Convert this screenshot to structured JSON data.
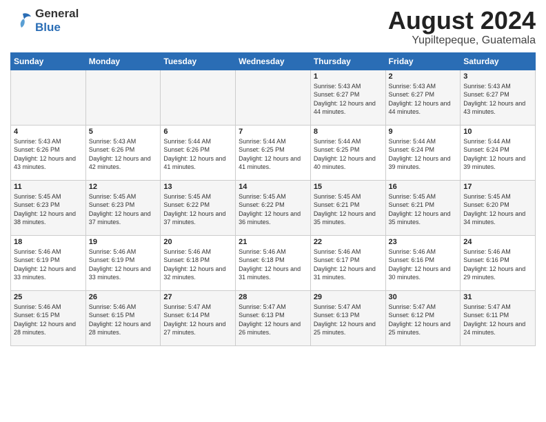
{
  "logo": {
    "general": "General",
    "blue": "Blue"
  },
  "title": {
    "month": "August 2024",
    "location": "Yupiltepeque, Guatemala"
  },
  "days_of_week": [
    "Sunday",
    "Monday",
    "Tuesday",
    "Wednesday",
    "Thursday",
    "Friday",
    "Saturday"
  ],
  "weeks": [
    [
      {
        "day": "",
        "sunrise": "",
        "sunset": "",
        "daylight": ""
      },
      {
        "day": "",
        "sunrise": "",
        "sunset": "",
        "daylight": ""
      },
      {
        "day": "",
        "sunrise": "",
        "sunset": "",
        "daylight": ""
      },
      {
        "day": "",
        "sunrise": "",
        "sunset": "",
        "daylight": ""
      },
      {
        "day": "1",
        "sunrise": "Sunrise: 5:43 AM",
        "sunset": "Sunset: 6:27 PM",
        "daylight": "Daylight: 12 hours and 44 minutes."
      },
      {
        "day": "2",
        "sunrise": "Sunrise: 5:43 AM",
        "sunset": "Sunset: 6:27 PM",
        "daylight": "Daylight: 12 hours and 44 minutes."
      },
      {
        "day": "3",
        "sunrise": "Sunrise: 5:43 AM",
        "sunset": "Sunset: 6:27 PM",
        "daylight": "Daylight: 12 hours and 43 minutes."
      }
    ],
    [
      {
        "day": "4",
        "sunrise": "Sunrise: 5:43 AM",
        "sunset": "Sunset: 6:26 PM",
        "daylight": "Daylight: 12 hours and 43 minutes."
      },
      {
        "day": "5",
        "sunrise": "Sunrise: 5:43 AM",
        "sunset": "Sunset: 6:26 PM",
        "daylight": "Daylight: 12 hours and 42 minutes."
      },
      {
        "day": "6",
        "sunrise": "Sunrise: 5:44 AM",
        "sunset": "Sunset: 6:26 PM",
        "daylight": "Daylight: 12 hours and 41 minutes."
      },
      {
        "day": "7",
        "sunrise": "Sunrise: 5:44 AM",
        "sunset": "Sunset: 6:25 PM",
        "daylight": "Daylight: 12 hours and 41 minutes."
      },
      {
        "day": "8",
        "sunrise": "Sunrise: 5:44 AM",
        "sunset": "Sunset: 6:25 PM",
        "daylight": "Daylight: 12 hours and 40 minutes."
      },
      {
        "day": "9",
        "sunrise": "Sunrise: 5:44 AM",
        "sunset": "Sunset: 6:24 PM",
        "daylight": "Daylight: 12 hours and 39 minutes."
      },
      {
        "day": "10",
        "sunrise": "Sunrise: 5:44 AM",
        "sunset": "Sunset: 6:24 PM",
        "daylight": "Daylight: 12 hours and 39 minutes."
      }
    ],
    [
      {
        "day": "11",
        "sunrise": "Sunrise: 5:45 AM",
        "sunset": "Sunset: 6:23 PM",
        "daylight": "Daylight: 12 hours and 38 minutes."
      },
      {
        "day": "12",
        "sunrise": "Sunrise: 5:45 AM",
        "sunset": "Sunset: 6:23 PM",
        "daylight": "Daylight: 12 hours and 37 minutes."
      },
      {
        "day": "13",
        "sunrise": "Sunrise: 5:45 AM",
        "sunset": "Sunset: 6:22 PM",
        "daylight": "Daylight: 12 hours and 37 minutes."
      },
      {
        "day": "14",
        "sunrise": "Sunrise: 5:45 AM",
        "sunset": "Sunset: 6:22 PM",
        "daylight": "Daylight: 12 hours and 36 minutes."
      },
      {
        "day": "15",
        "sunrise": "Sunrise: 5:45 AM",
        "sunset": "Sunset: 6:21 PM",
        "daylight": "Daylight: 12 hours and 35 minutes."
      },
      {
        "day": "16",
        "sunrise": "Sunrise: 5:45 AM",
        "sunset": "Sunset: 6:21 PM",
        "daylight": "Daylight: 12 hours and 35 minutes."
      },
      {
        "day": "17",
        "sunrise": "Sunrise: 5:45 AM",
        "sunset": "Sunset: 6:20 PM",
        "daylight": "Daylight: 12 hours and 34 minutes."
      }
    ],
    [
      {
        "day": "18",
        "sunrise": "Sunrise: 5:46 AM",
        "sunset": "Sunset: 6:19 PM",
        "daylight": "Daylight: 12 hours and 33 minutes."
      },
      {
        "day": "19",
        "sunrise": "Sunrise: 5:46 AM",
        "sunset": "Sunset: 6:19 PM",
        "daylight": "Daylight: 12 hours and 33 minutes."
      },
      {
        "day": "20",
        "sunrise": "Sunrise: 5:46 AM",
        "sunset": "Sunset: 6:18 PM",
        "daylight": "Daylight: 12 hours and 32 minutes."
      },
      {
        "day": "21",
        "sunrise": "Sunrise: 5:46 AM",
        "sunset": "Sunset: 6:18 PM",
        "daylight": "Daylight: 12 hours and 31 minutes."
      },
      {
        "day": "22",
        "sunrise": "Sunrise: 5:46 AM",
        "sunset": "Sunset: 6:17 PM",
        "daylight": "Daylight: 12 hours and 31 minutes."
      },
      {
        "day": "23",
        "sunrise": "Sunrise: 5:46 AM",
        "sunset": "Sunset: 6:16 PM",
        "daylight": "Daylight: 12 hours and 30 minutes."
      },
      {
        "day": "24",
        "sunrise": "Sunrise: 5:46 AM",
        "sunset": "Sunset: 6:16 PM",
        "daylight": "Daylight: 12 hours and 29 minutes."
      }
    ],
    [
      {
        "day": "25",
        "sunrise": "Sunrise: 5:46 AM",
        "sunset": "Sunset: 6:15 PM",
        "daylight": "Daylight: 12 hours and 28 minutes."
      },
      {
        "day": "26",
        "sunrise": "Sunrise: 5:46 AM",
        "sunset": "Sunset: 6:15 PM",
        "daylight": "Daylight: 12 hours and 28 minutes."
      },
      {
        "day": "27",
        "sunrise": "Sunrise: 5:47 AM",
        "sunset": "Sunset: 6:14 PM",
        "daylight": "Daylight: 12 hours and 27 minutes."
      },
      {
        "day": "28",
        "sunrise": "Sunrise: 5:47 AM",
        "sunset": "Sunset: 6:13 PM",
        "daylight": "Daylight: 12 hours and 26 minutes."
      },
      {
        "day": "29",
        "sunrise": "Sunrise: 5:47 AM",
        "sunset": "Sunset: 6:13 PM",
        "daylight": "Daylight: 12 hours and 25 minutes."
      },
      {
        "day": "30",
        "sunrise": "Sunrise: 5:47 AM",
        "sunset": "Sunset: 6:12 PM",
        "daylight": "Daylight: 12 hours and 25 minutes."
      },
      {
        "day": "31",
        "sunrise": "Sunrise: 5:47 AM",
        "sunset": "Sunset: 6:11 PM",
        "daylight": "Daylight: 12 hours and 24 minutes."
      }
    ]
  ]
}
